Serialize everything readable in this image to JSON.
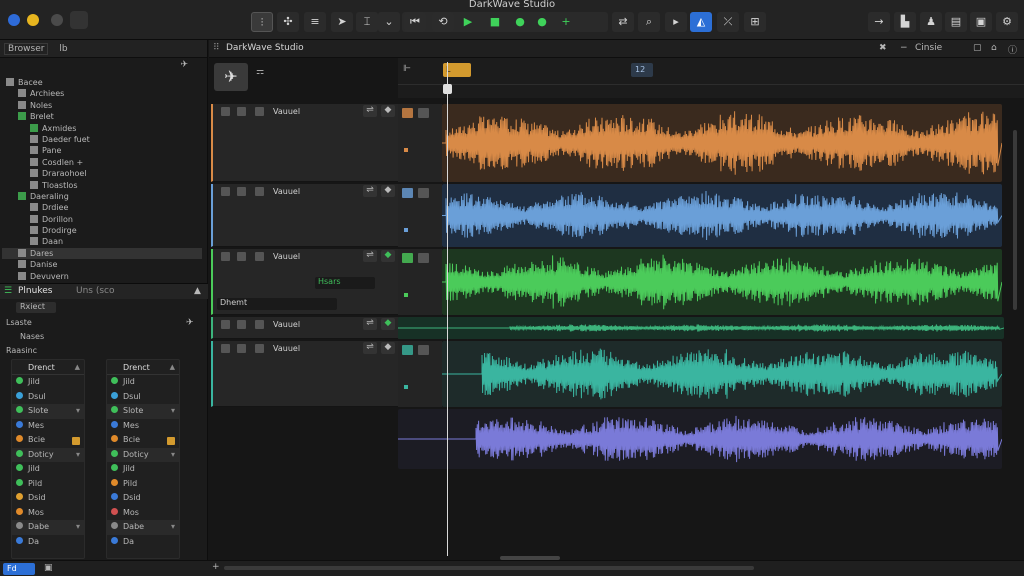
{
  "app": {
    "title": "DarkWave Studio"
  },
  "toolbar": {
    "colors": {
      "accent": "#2c6fd6",
      "record": "#3fd25a"
    }
  },
  "browser": {
    "tabs": [
      "Browser",
      "lb"
    ],
    "items": [
      {
        "label": "Bacee",
        "indent": 0,
        "color": "gray"
      },
      {
        "label": "Archiees",
        "indent": 1,
        "color": "gray"
      },
      {
        "label": "Noles",
        "indent": 1,
        "color": "gray"
      },
      {
        "label": "Brelet",
        "indent": 1,
        "color": "green"
      },
      {
        "label": "Axmides",
        "indent": 2,
        "color": "green"
      },
      {
        "label": "Daeder fuet",
        "indent": 2,
        "color": "gray"
      },
      {
        "label": "Pane",
        "indent": 2,
        "color": "gray"
      },
      {
        "label": "Cosdlen +",
        "indent": 2,
        "color": "gray"
      },
      {
        "label": "Draraohoel",
        "indent": 2,
        "color": "gray"
      },
      {
        "label": "Tloastlos",
        "indent": 2,
        "color": "gray"
      },
      {
        "label": "Daeraling",
        "indent": 1,
        "color": "green"
      },
      {
        "label": "Drdiee",
        "indent": 2,
        "color": "gray"
      },
      {
        "label": "Dorillon",
        "indent": 2,
        "color": "gray"
      },
      {
        "label": "Drodirge",
        "indent": 2,
        "color": "gray"
      },
      {
        "label": "Daan",
        "indent": 2,
        "color": "gray"
      },
      {
        "label": "Dares",
        "indent": 1,
        "color": "gray",
        "selected": true
      },
      {
        "label": "Danise",
        "indent": 1,
        "color": "gray"
      },
      {
        "label": "Devuvern",
        "indent": 1,
        "color": "gray"
      }
    ]
  },
  "plugins": {
    "title": "Plnukes",
    "subtitle": "Uns (sco",
    "search": "Rxiect",
    "filter1": "Lsaste",
    "filter2": "Nases",
    "filter3": "Raasinc",
    "strips": [
      {
        "name": "Drenct",
        "rows": [
          {
            "label": "Jild",
            "color": "#3fbf5a"
          },
          {
            "label": "Dsul",
            "color": "#3aa0d8"
          },
          {
            "label": "Slote",
            "color": "#3fbf5a",
            "dropdown": true
          },
          {
            "label": "Mes",
            "color": "#3a7ad8"
          },
          {
            "label": "Bcie",
            "color": "#e08a2a",
            "badge": true
          },
          {
            "label": "Doticy",
            "color": "#3fbf5a",
            "dropdown": true
          },
          {
            "label": "Jild",
            "color": "#3fbf5a"
          },
          {
            "label": "Pild",
            "color": "#3fbf5a"
          },
          {
            "label": "Dsid",
            "color": "#e0a030"
          },
          {
            "label": "Mos",
            "color": "#e08a2a"
          },
          {
            "label": "Dabe",
            "color": "#8a8a8a",
            "dropdown": true
          },
          {
            "label": "Da",
            "color": "#3a7ad8"
          }
        ]
      },
      {
        "name": "Drenct",
        "rows": [
          {
            "label": "Jild",
            "color": "#3fbf5a"
          },
          {
            "label": "Dsul",
            "color": "#3aa0d8"
          },
          {
            "label": "Slote",
            "color": "#3fbf5a",
            "dropdown": true
          },
          {
            "label": "Mes",
            "color": "#3a7ad8"
          },
          {
            "label": "Bcie",
            "color": "#e08a2a",
            "badge": true
          },
          {
            "label": "Doticy",
            "color": "#3fbf5a",
            "dropdown": true
          },
          {
            "label": "Jild",
            "color": "#3fbf5a"
          },
          {
            "label": "Pild",
            "color": "#e08a2a"
          },
          {
            "label": "Dsid",
            "color": "#3a7ad8"
          },
          {
            "label": "Mos",
            "color": "#d05050"
          },
          {
            "label": "Dabe",
            "color": "#8a8a8a",
            "dropdown": true
          },
          {
            "label": "Da",
            "color": "#3a7ad8"
          }
        ]
      }
    ]
  },
  "arrange": {
    "tab_title": "DarkWave Studio",
    "header_right": "Cinsie",
    "markers": [
      "L",
      "12"
    ],
    "tracks": [
      {
        "name": "Vauuel",
        "color": "#d88a47",
        "lane_bg": "#3a2a1e"
      },
      {
        "name": "Vauuel",
        "color": "#6a9fd8",
        "lane_bg": "#1f2e42"
      },
      {
        "name": "Vauuel",
        "color": "#4bcb5a",
        "lane_bg": "#1d3720",
        "extra_label": "Hsars",
        "extra_label2": "Dhemt"
      },
      {
        "name": "Vauuel",
        "color": "#3cb47c",
        "lane_bg": "#173126"
      },
      {
        "name": "Vauuel",
        "color": "#3ab5a0",
        "lane_bg": "#1e2b2a"
      },
      {
        "name": "",
        "color": "#7a7ad8",
        "lane_bg": "#1c1c24"
      }
    ]
  },
  "statusbar": {
    "label": "Fd"
  }
}
